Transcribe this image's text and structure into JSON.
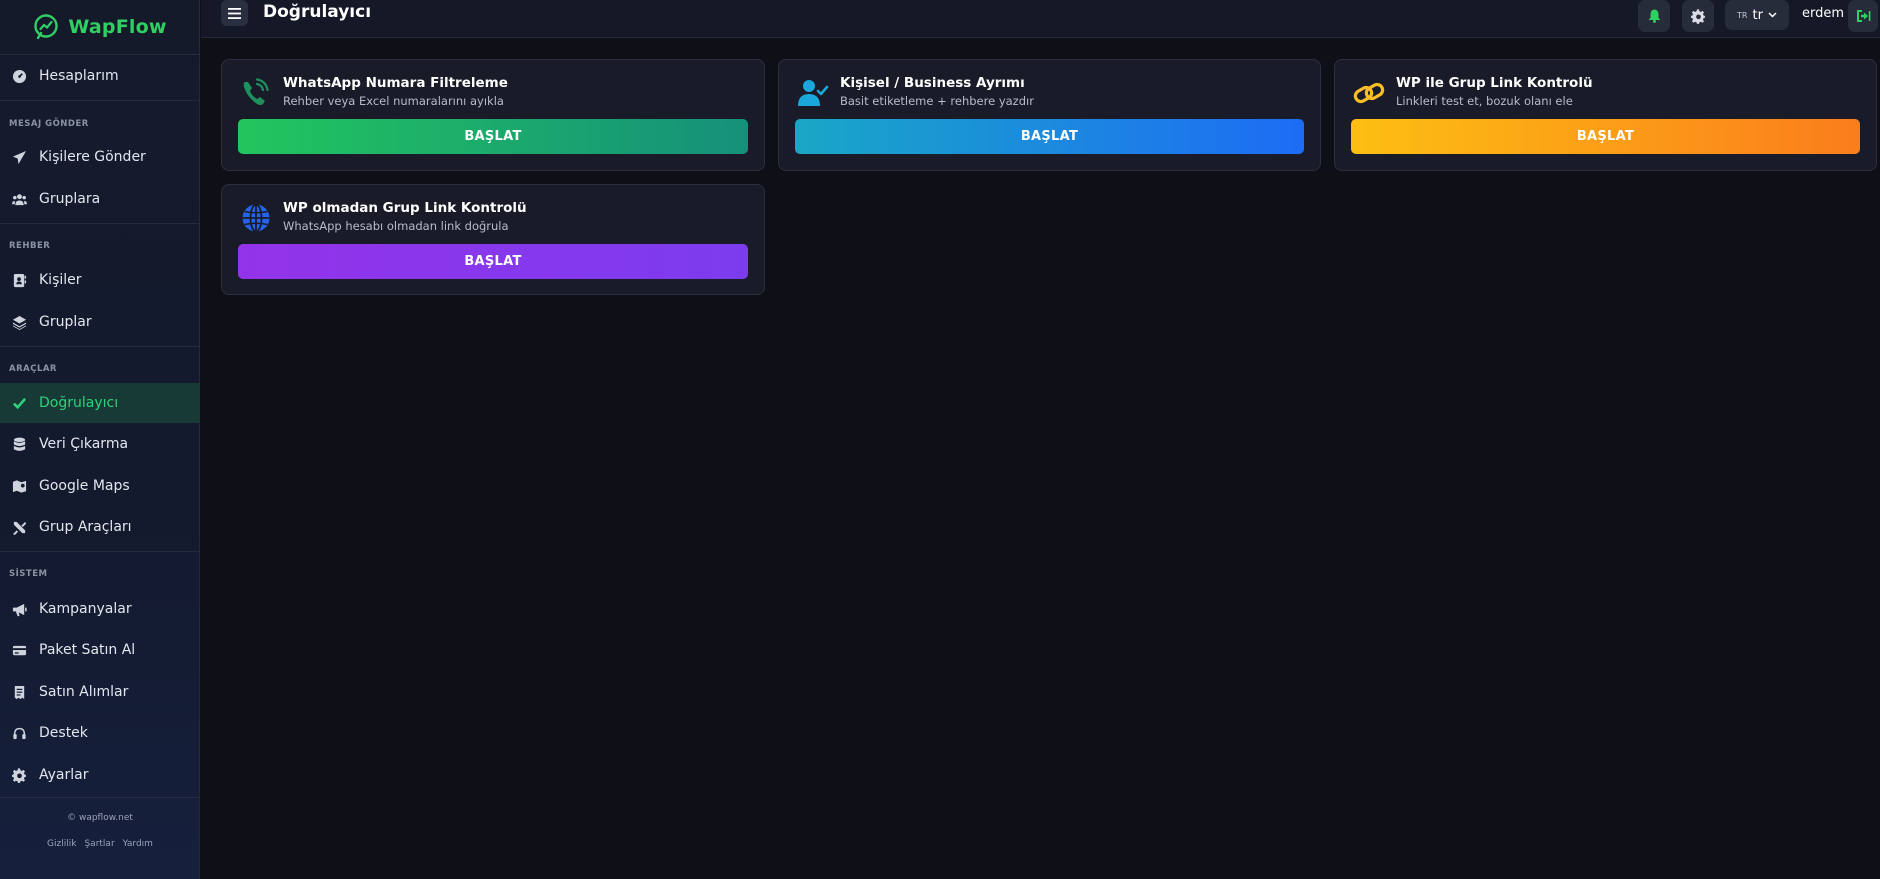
{
  "brand": {
    "name": "WapFlow"
  },
  "topbar": {
    "title": "Doğrulayıcı",
    "lang_flag": "TR",
    "lang_code": "tr",
    "username": "erdem"
  },
  "sidebar": {
    "top_item": "Hesaplarım",
    "sections": {
      "send": "MESAJ GÖNDER",
      "contacts": "REHBER",
      "tools": "ARAÇLAR",
      "system": "SİSTEM"
    },
    "items": {
      "send_contacts": "Kişilere Gönder",
      "send_groups": "Gruplara",
      "contacts": "Kişiler",
      "groups": "Gruplar",
      "validator": "Doğrulayıcı",
      "extract": "Veri Çıkarma",
      "maps": "Google Maps",
      "group_tools": "Grup Araçları",
      "campaigns": "Kampanyalar",
      "buy_package": "Paket Satın Al",
      "purchases": "Satın Alımlar",
      "support": "Destek",
      "settings": "Ayarlar"
    },
    "footer": {
      "copy": "© wapflow.net",
      "privacy": "Gizlilik",
      "terms": "Şartlar",
      "help": "Yardım"
    }
  },
  "cards": [
    {
      "title": "WhatsApp Numara Filtreleme",
      "subtitle": "Rehber veya Excel numaralarını ayıkla",
      "button": "BAŞLAT"
    },
    {
      "title": "Kişisel / Business Ayrımı",
      "subtitle": "Basit etiketleme + rehbere yazdır",
      "button": "BAŞLAT"
    },
    {
      "title": "WP ile Grup Link Kontrolü",
      "subtitle": "Linkleri test et, bozuk olanı ele",
      "button": "BAŞLAT"
    },
    {
      "title": "WP olmadan Grup Link Kontrolü",
      "subtitle": "WhatsApp hesabı olmadan link doğrula",
      "button": "BAŞLAT"
    }
  ],
  "colors": {
    "accent": "#2fcf62",
    "btn_green": [
      "#22c55e",
      "#15907a"
    ],
    "btn_blue": [
      "#1aa7c6",
      "#1d6cf5"
    ],
    "btn_orange": [
      "#fcbf12",
      "#fb7d1c"
    ],
    "btn_purple": [
      "#9333ea",
      "#7c3ced"
    ]
  }
}
